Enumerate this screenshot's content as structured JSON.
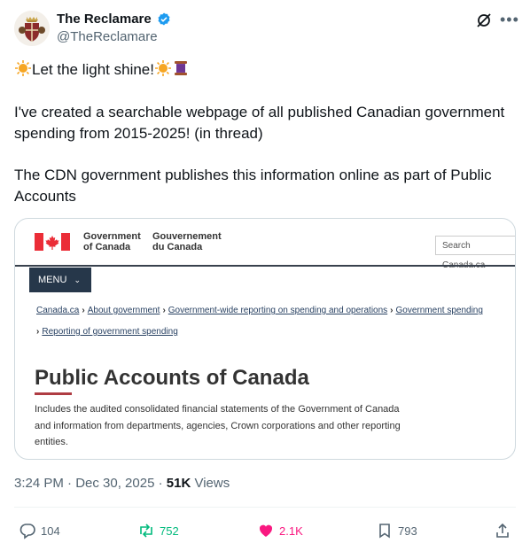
{
  "author": {
    "name": "The Reclamare",
    "handle": "@TheReclamare"
  },
  "tweet": {
    "line1": "Let the light shine!",
    "para2": "I've created a searchable webpage of all published Canadian government spending from 2015-2025! (in thread)",
    "para3": "The CDN government publishes this information online as part of Public Accounts"
  },
  "card": {
    "gov_en_1": "Government",
    "gov_en_2": "of Canada",
    "gov_fr_1": "Gouvernement",
    "gov_fr_2": "du Canada",
    "search_placeholder": "Search Canada.ca",
    "menu_label": "MENU",
    "breadcrumbs": [
      "Canada.ca",
      "About government",
      "Government-wide reporting on spending and operations",
      "Government spending",
      "Reporting of government spending"
    ],
    "title": "Public Accounts of Canada",
    "description": "Includes the audited consolidated financial statements of the Government of Canada and information from departments, agencies, Crown corporations and other reporting entities."
  },
  "meta": {
    "time": "3:24 PM · Dec 30, 2025 ·",
    "views_count": "51K",
    "views_label": "Views"
  },
  "actions": {
    "replies": "104",
    "reposts": "752",
    "likes": "2.1K",
    "bookmarks": "793"
  },
  "colors": {
    "repost": "#00ba7c",
    "like": "#f91880",
    "verified": "#1d9bf0",
    "canada_red": "#eb2d37"
  }
}
